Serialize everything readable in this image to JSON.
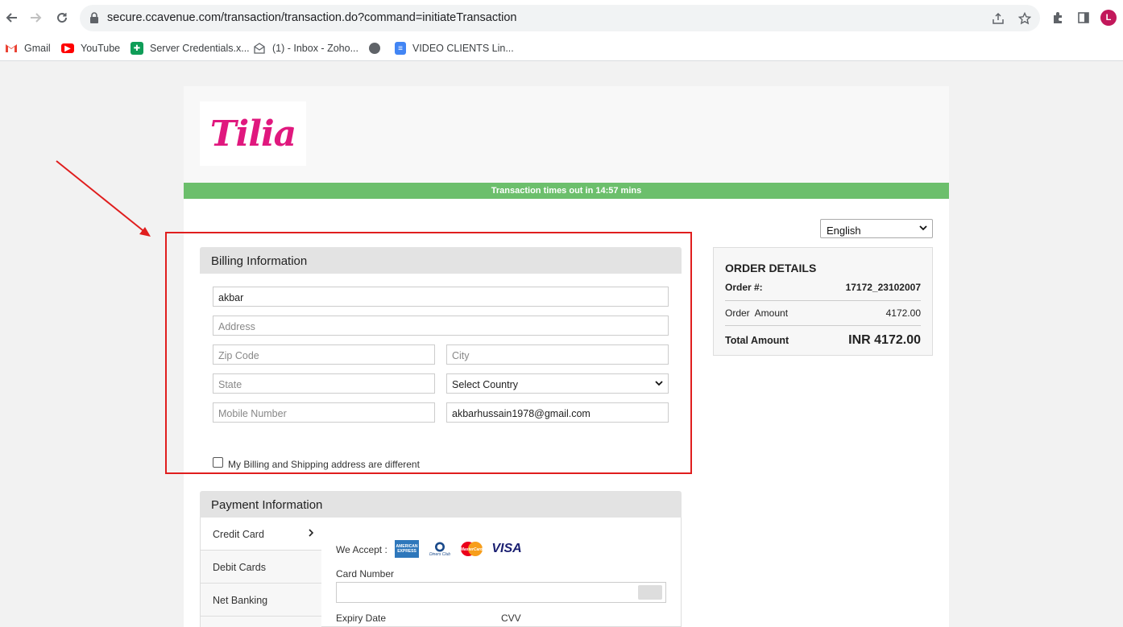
{
  "browser": {
    "url": "secure.ccavenue.com/transaction/transaction.do?command=initiateTransaction",
    "profile_initial": "L",
    "bookmarks": [
      {
        "label": "Gmail",
        "icon": "gmail-icon"
      },
      {
        "label": "YouTube",
        "icon": "youtube-icon"
      },
      {
        "label": "Server Credentials.x...",
        "icon": "sheets-icon"
      },
      {
        "label": "(1) - Inbox - Zoho...",
        "icon": "zoho-mail-icon"
      },
      {
        "label": "",
        "icon": "globe-icon"
      },
      {
        "label": "VIDEO CLIENTS Lin...",
        "icon": "docs-icon"
      }
    ]
  },
  "merchant": {
    "logo_text": "Tilia",
    "logo_color": "#e0187e"
  },
  "timer": {
    "text": "Transaction times out in 14:57 mins",
    "color": "#6cbf6c"
  },
  "language": {
    "selected": "English"
  },
  "billing": {
    "title": "Billing Information",
    "name_value": "akbar",
    "address_placeholder": "Address",
    "zip_placeholder": "Zip Code",
    "city_placeholder": "City",
    "state_placeholder": "State",
    "country_selected": "Select Country",
    "mobile_placeholder": "Mobile Number",
    "email_value": "akbarhussain1978@gmail.com",
    "different_address_label": "My Billing and Shipping address are different"
  },
  "order": {
    "title": "ORDER DETAILS",
    "order_no_label": "Order #:",
    "order_no_value": "17172_23102007",
    "amount_label": "Order  Amount",
    "amount_value": "4172.00",
    "total_label": "Total Amount",
    "total_value": "INR 4172.00"
  },
  "payment": {
    "title": "Payment Information",
    "tabs": [
      "Credit Card",
      "Debit Cards",
      "Net Banking"
    ],
    "we_accept_label": "We Accept :",
    "card_brands": [
      "AMERICAN EXPRESS",
      "Diners Club",
      "MasterCard",
      "VISA"
    ],
    "card_number_label": "Card Number",
    "expiry_label": "Expiry Date",
    "cvv_label": "CVV"
  },
  "annotation": {
    "highlight_color": "#e01e1e"
  }
}
